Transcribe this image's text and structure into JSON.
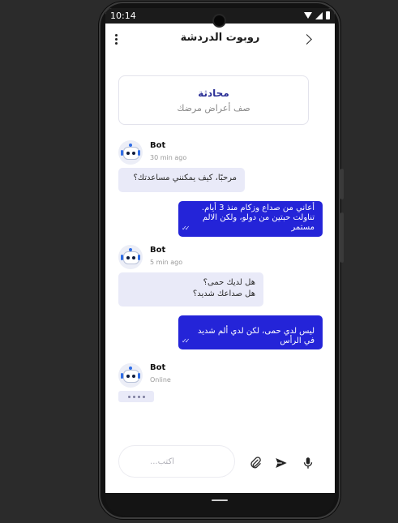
{
  "status_bar": {
    "time": "10:14"
  },
  "header": {
    "title": "روبوت الدردشة"
  },
  "intro": {
    "title": "محادثة",
    "subtitle": "صف أعراض مرضك"
  },
  "messages": [
    {
      "sender": "Bot",
      "meta": "30 min ago",
      "text": "مرحبًا، كيف يمكنني مساعدتك؟"
    },
    {
      "sender": "user",
      "text": "أعاني من صداع وزكام منذ 3 أيام. تناولت حبتين من دولو، ولكن الالم مستمر"
    },
    {
      "sender": "Bot",
      "meta": "5 min ago",
      "lines": [
        "هل لديك حمى؟",
        "هل صداعك شديد؟"
      ]
    },
    {
      "sender": "user",
      "text": "ليس لدي حمى، لكن لدي ألم شديد في الرأس"
    },
    {
      "sender": "Bot",
      "meta": "Online"
    }
  ],
  "composer": {
    "placeholder": "أكتب..."
  },
  "icons": {
    "attach": "paperclip-icon",
    "send": "send-icon",
    "mic": "microphone-icon",
    "back": "chevron-back-icon",
    "menu": "more-vertical-icon"
  },
  "colors": {
    "accent": "#2424d8",
    "bot_bubble": "#e9eaf8",
    "title": "#2a2f96"
  }
}
